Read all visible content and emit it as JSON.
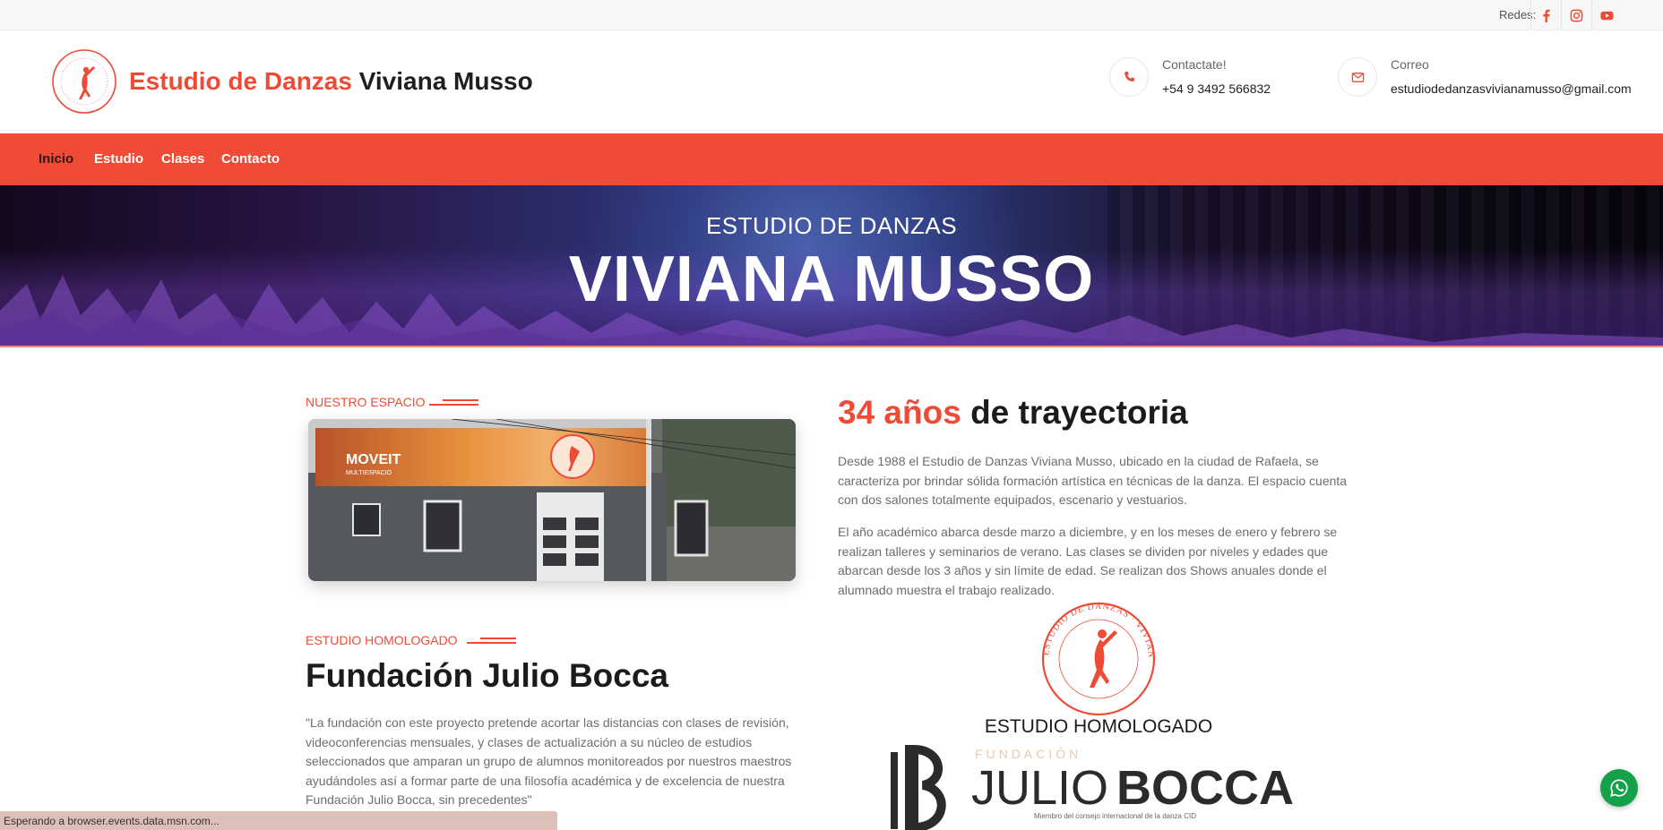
{
  "topbar": {
    "redes_label": "Redes:",
    "social": [
      {
        "icon": "facebook-icon"
      },
      {
        "icon": "instagram-icon"
      },
      {
        "icon": "youtube-icon"
      }
    ]
  },
  "header": {
    "brand_part1": "Estudio de Danzas",
    "brand_part2": "Viviana Musso",
    "phone": {
      "label": "Contactate!",
      "value": "+54 9 3492 566832",
      "icon": "phone-icon"
    },
    "email": {
      "label": "Correo",
      "value": "estudiodedanzasvivianamusso@gmail.com",
      "icon": "envelope-icon"
    }
  },
  "nav": {
    "items": [
      {
        "label": "Inicio",
        "active": true
      },
      {
        "label": "Estudio"
      },
      {
        "label": "Clases"
      },
      {
        "label": "Contacto"
      }
    ]
  },
  "hero": {
    "subtitle": "ESTUDIO DE DANZAS",
    "title": "VIVIANA MUSSO"
  },
  "espacio": {
    "label": "NUESTRO ESPACIO",
    "photo_sign": "MOVEIT",
    "photo_sign_sub": "MULTIESPACIO"
  },
  "trayectoria": {
    "title_red": "34 años",
    "title_rest": "de trayectoria",
    "p1": "Desde 1988 el Estudio de Danzas Viviana Musso, ubicado en la ciudad de Rafaela, se caracteriza por brindar sólida formación artística en técnicas de la danza. El espacio cuenta con dos salones totalmente equipados, escenario y vestuarios.",
    "p2": "El año académico abarca desde marzo a diciembre, y en los meses de enero y febrero se realizan talleres y seminarios de verano. Las clases se dividen por niveles y edades que abarcan desde los 3 años y sin límite de edad. Se realizan dos Shows anuales donde el alumnado muestra el trabajo realizado."
  },
  "homologado": {
    "label": "ESTUDIO HOMOLOGADO",
    "title": "Fundación Julio Bocca",
    "quote": "\"La fundación con este proyecto pretende acortar las distancias con clases de revisión, videoconferencias mensuales, y clases de actualización a su núcleo de estudios seleccionados que amparan un grupo de alumnos monitoreados por nuestros maestros ayudándoles así a formar parte de una filosofía académica y de excelencia de nuestra Fundación Julio Bocca, sin precedentes\"",
    "logo_seal_text": "ESTUDIO DE DANZAS · VIVIANA MUSSO · RAFAELA",
    "logo_caption": "ESTUDIO HOMOLOGADO",
    "logo_fundacion": "FUNDACIÓN",
    "logo_julio": "JULIO",
    "logo_bocca": "BOCCA",
    "logo_member": "Miembro del consejo internacional de la danza CID"
  },
  "status_bar": "Esperando a browser.events.data.msn.com...",
  "whatsapp": {
    "icon": "whatsapp-icon"
  },
  "colors": {
    "accent": "#ee4b36",
    "nav": "#f04b36",
    "whatsapp": "#13a14a"
  }
}
